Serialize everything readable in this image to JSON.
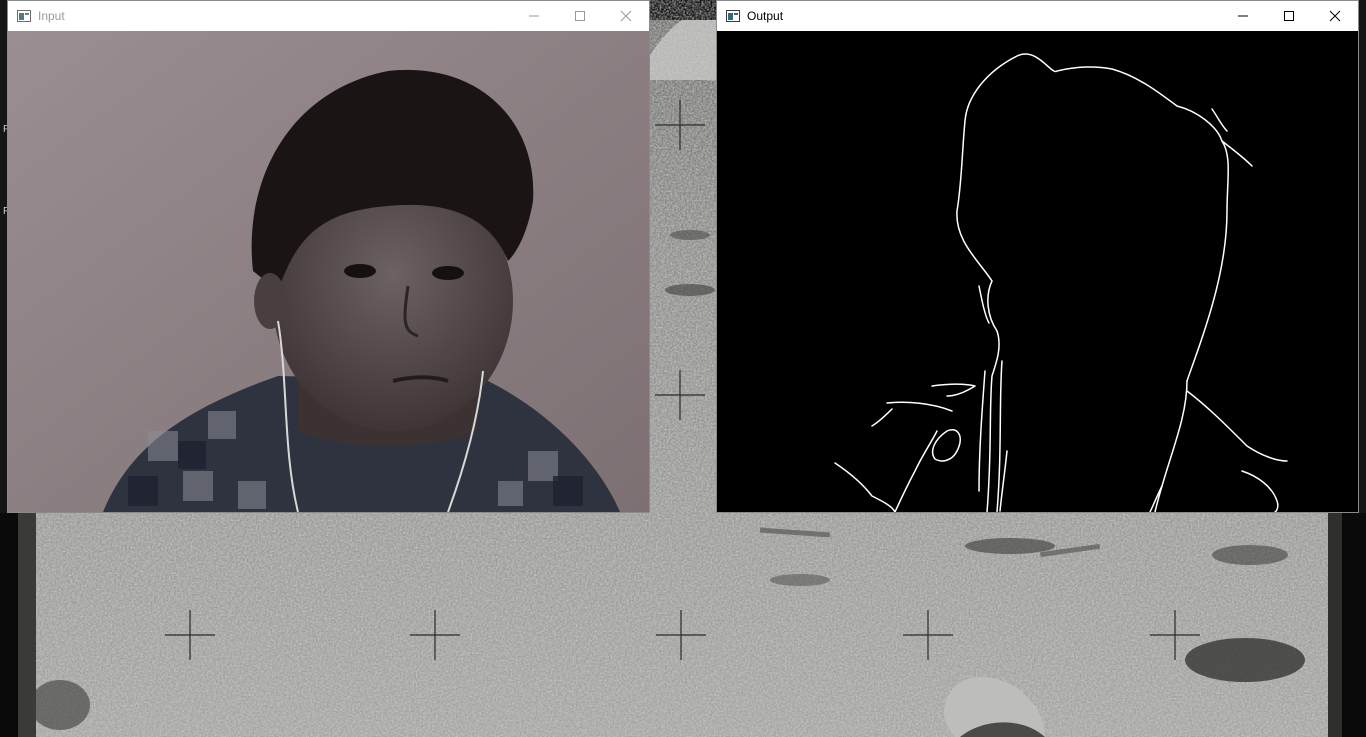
{
  "desktop": {
    "wallpaper_name": "lunar-surface-photo",
    "left_edge_glyphs": [
      "P",
      "P"
    ]
  },
  "windows": {
    "input": {
      "title": "Input",
      "active": false,
      "icon": "app-window-icon",
      "content": "webcam-frame-person"
    },
    "output": {
      "title": "Output",
      "active": true,
      "icon": "app-window-icon",
      "content": "edge-detection-result"
    }
  },
  "controls": {
    "minimize_icon": "minimize-icon",
    "maximize_icon": "maximize-icon",
    "close_icon": "close-icon"
  },
  "colors": {
    "titlebar": "#ffffff",
    "output_background": "#000000",
    "edge_lines": "#ffffff"
  }
}
